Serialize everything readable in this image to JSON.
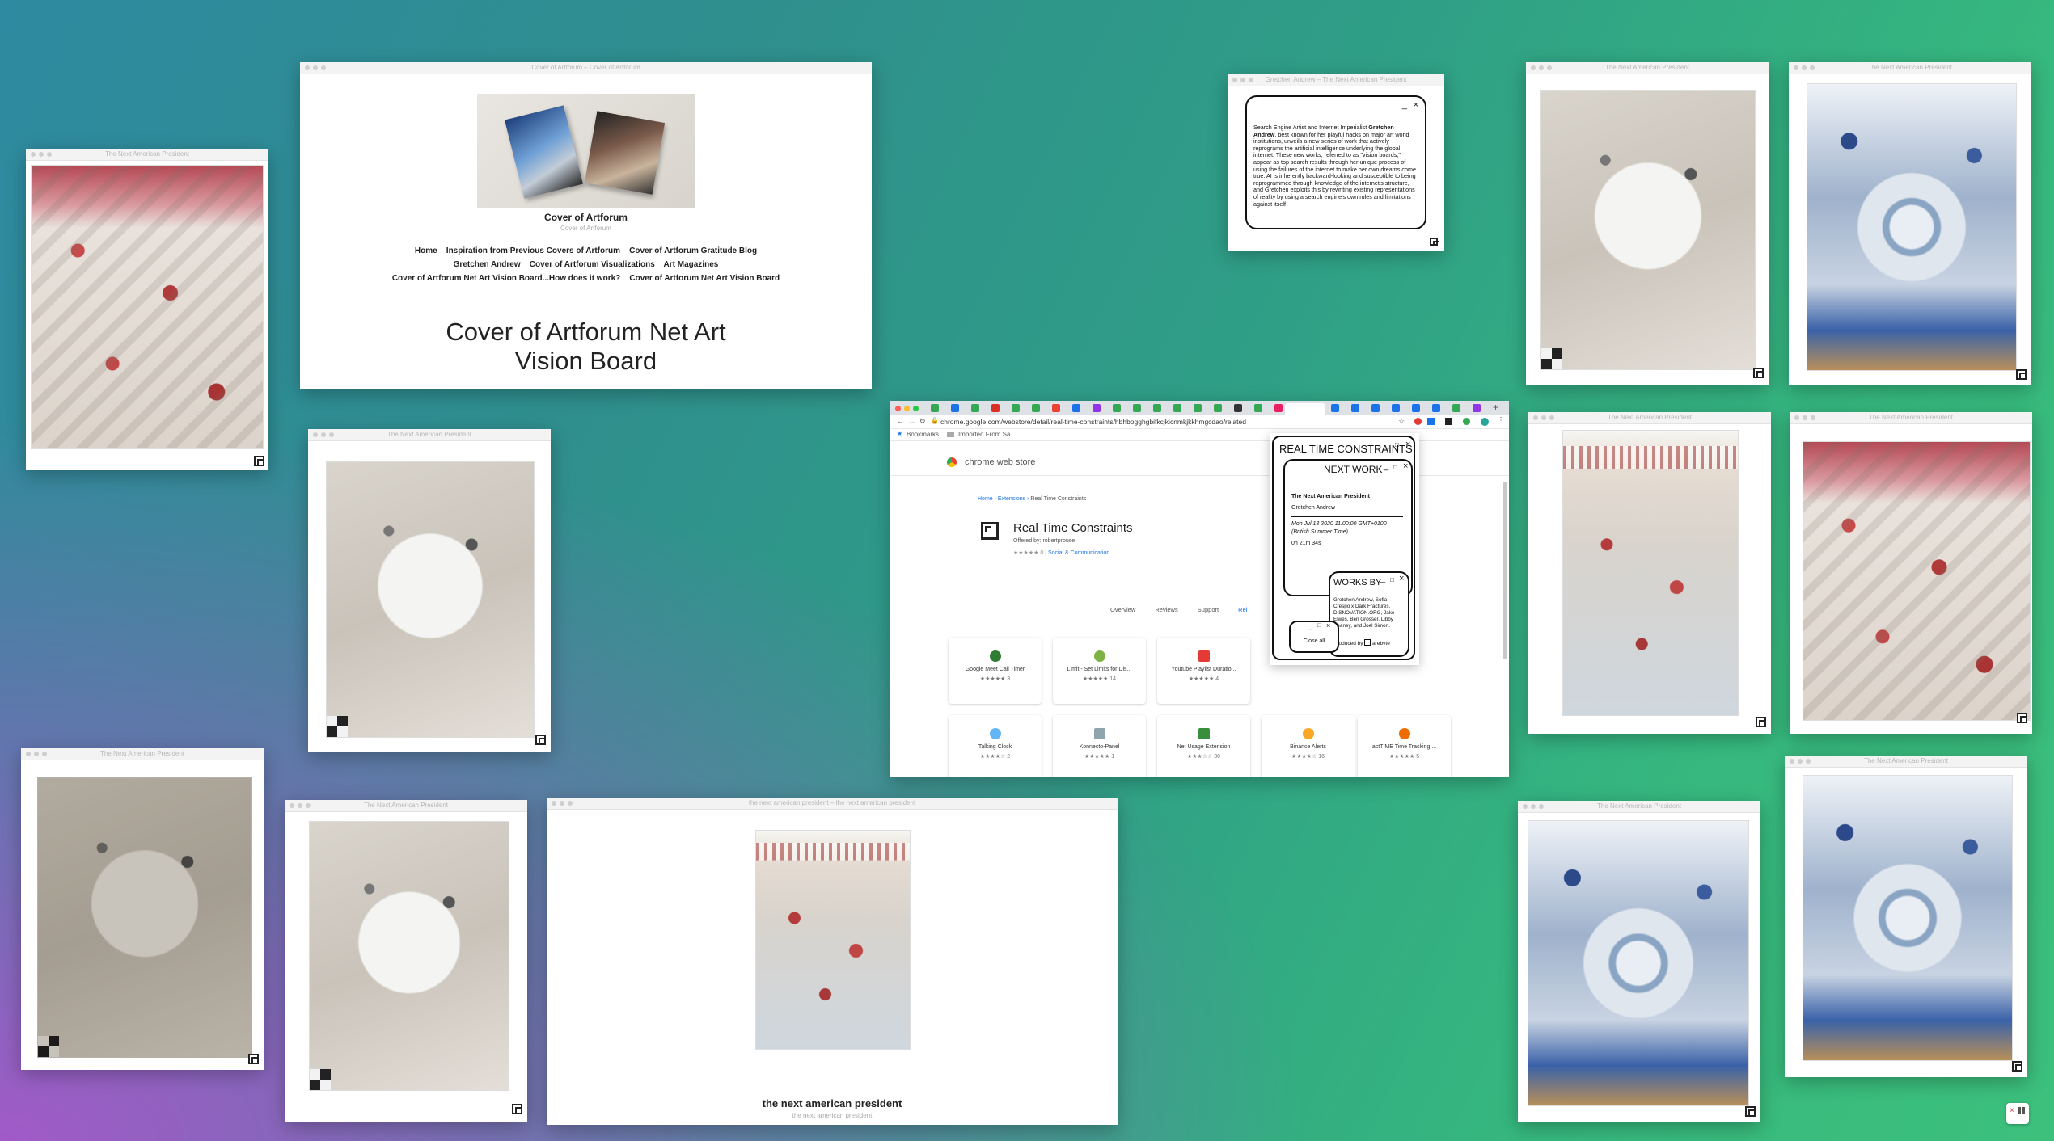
{
  "thumb_title": "The Next American President",
  "artforum": {
    "tb_title": "Cover of Artforum – Cover of Artforum",
    "site_title": "Cover of Artforum",
    "site_tagline": "Cover of Artforum",
    "nav": [
      "Home",
      "Inspiration from Previous Covers of Artforum",
      "Cover of Artforum Gratitude Blog",
      "Gretchen Andrew",
      "Cover of Artforum Visualizations",
      "Art Magazines",
      "Cover of Artforum Net Art Vision Board...How does it work?",
      "Cover of Artforum Net Art Vision Board"
    ],
    "heading_line1": "Cover of Artforum Net Art",
    "heading_line2": "Vision Board"
  },
  "about": {
    "tb_title": "Gretchen Andrew – The Next American President",
    "text_before": "Search Engine Artist and Internet Imperialist ",
    "text_bold": "Gretchen Andrew",
    "text_after": ", best known for her playful hacks on major art world institutions, unveils a new series of work that actively reprograms the artificial intelligence underlying the global internet. These new works, referred to as \"vision boards,\" appear as top search results through her unique process of using the failures of the internet to make her own dreams come true. AI is inherently backward-looking and susceptible to being reprogrammed through knowledge of the internet's structure, and Gretchen exploits this by rewriting existing representations of reality by using a search engine's own rules and limitations against itself"
  },
  "nap_window": {
    "tb_title": "the next american president – the next american president",
    "title": "the next american president",
    "subtitle": "the next american president"
  },
  "chrome": {
    "url": "chrome.google.com/webstore/detail/real-time-constraints/hbhbogghgbifkcjkicnmkjkkhmgcdao/related",
    "bookmarks": "Bookmarks",
    "imported": "Imported From Sa...",
    "store_name": "chrome web store",
    "breadcrumb": [
      "Home",
      "Extensions",
      "Real Time Constraints"
    ],
    "ext_name": "Real Time Constraints",
    "offered_by": "Offered by: robertprouse",
    "rating_count": "0",
    "category": "Social & Communication",
    "tabs": [
      "Overview",
      "Reviews",
      "Support",
      "Rel"
    ],
    "cards_row1": [
      {
        "name": "Google Meet Call Timer",
        "stars": "★★★★★",
        "count": "3",
        "color": "#2e7d32"
      },
      {
        "name": "Limit - Set Limits for Dis...",
        "stars": "★★★★★",
        "count": "14",
        "color": "#7cb342"
      },
      {
        "name": "Youtube Playlist Duratio...",
        "stars": "★★★★★",
        "count": "4",
        "color": "#e53935"
      }
    ],
    "cards_row2": [
      {
        "name": "Talking Clock",
        "stars": "★★★★☆",
        "count": "2",
        "color": "#64b5f6"
      },
      {
        "name": "Konnecto-Panel",
        "stars": "★★★★★",
        "count": "1",
        "color": "#90a4ae"
      },
      {
        "name": "Net Usage Extension",
        "stars": "★★★☆☆",
        "count": "30",
        "color": "#388e3c"
      },
      {
        "name": "Binance Alerts",
        "stars": "★★★★☆",
        "count": "16",
        "color": "#f9a825"
      },
      {
        "name": "actTIME Time Tracking ...",
        "stars": "★★★★★",
        "count": "5",
        "color": "#ef6c00"
      }
    ]
  },
  "rtc": {
    "title": "REAL TIME CONSTRAINTS",
    "next_work": "NEXT WORK",
    "work_title": "The Next American President",
    "work_artist": "Gretchen Andrew",
    "work_date": "Mon Jul 13 2020 11:00:00 GMT+0100 (British Summer Time)",
    "work_timer": "0h 21m 34s",
    "works_by": "WORKS BY",
    "works_by_text": "Gretchen Andrew, Sofia Crespo x Dark Fractures, DISNOVATION.ORG, Jake Elwes, Ben Grosser, Libby Heaney, and Joel Simon.",
    "produced_by": "Produced by",
    "producer": "arebyte",
    "close_all": "Close all",
    "ctrl_min": "_",
    "ctrl_max": "□",
    "ctrl_close": "×"
  }
}
